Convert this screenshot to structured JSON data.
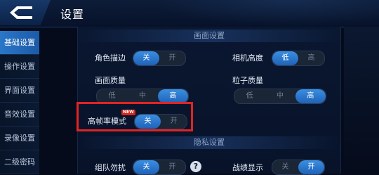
{
  "header": {
    "title": "设置"
  },
  "sidebar": {
    "items": [
      {
        "label": "基础设置"
      },
      {
        "label": "操作设置"
      },
      {
        "label": "界面设置"
      },
      {
        "label": "音效设置"
      },
      {
        "label": "录像设置"
      },
      {
        "label": "二级密码"
      }
    ],
    "active_index": 0
  },
  "sections": {
    "display": {
      "title": "画面设置"
    },
    "privacy": {
      "title": "隐私设置"
    }
  },
  "settings": {
    "outline": {
      "label": "角色描边",
      "options": [
        "关",
        "开"
      ],
      "selected": "关"
    },
    "camera_height": {
      "label": "相机高度",
      "options": [
        "低",
        "高"
      ],
      "selected": "低"
    },
    "quality": {
      "label": "画面质量",
      "options": [
        "低",
        "中",
        "高"
      ],
      "selected": "高"
    },
    "particle": {
      "label": "粒子质量",
      "options": [
        "低",
        "中",
        "高"
      ],
      "selected": "高"
    },
    "high_fps": {
      "label": "高帧率模式",
      "badge": "NEW",
      "options": [
        "关",
        "开"
      ],
      "selected": "关"
    },
    "team_dnd": {
      "label": "组队勿扰",
      "options": [
        "关",
        "开"
      ],
      "selected": "关",
      "help": "?"
    },
    "record_display": {
      "label": "战绩显示",
      "options": [
        "关",
        "开"
      ],
      "selected": "开"
    }
  },
  "colors": {
    "accent": "#2a76c8",
    "highlight_box": "#e02424",
    "badge": "#d9251d"
  }
}
